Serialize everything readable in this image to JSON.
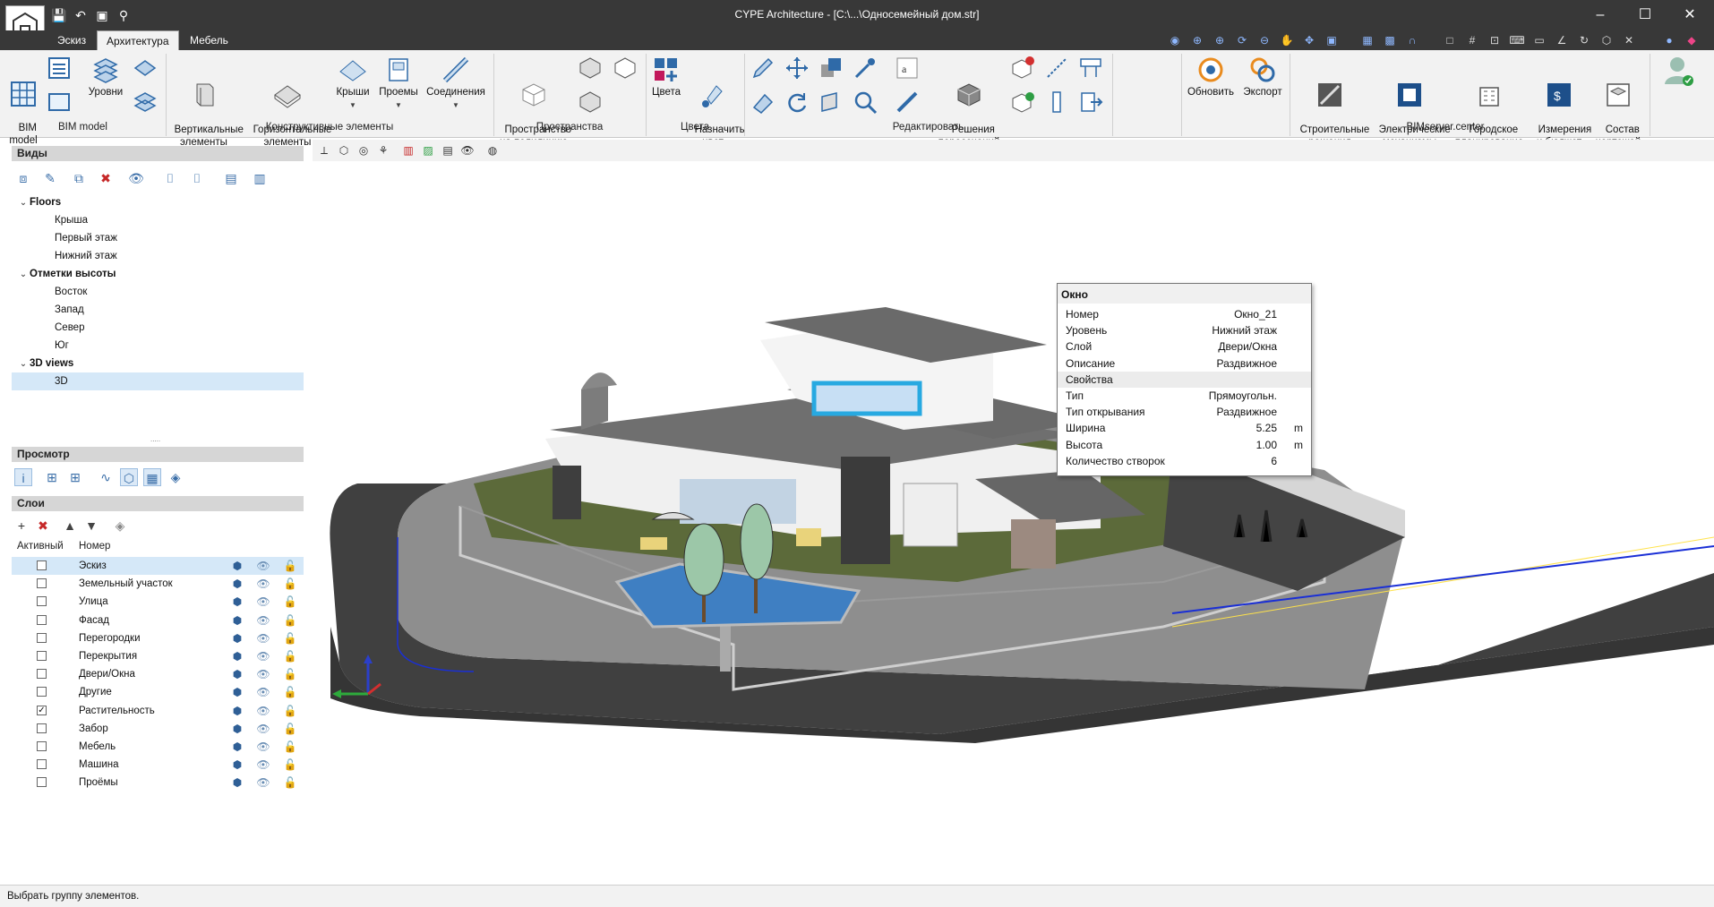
{
  "window": {
    "title": "CYPE Architecture - [C:\\...\\Односемейный дом.str]"
  },
  "tabs": [
    "Эскиз",
    "Архитектура",
    "Мебель"
  ],
  "ribbon": {
    "bim": {
      "model_label": "BIM\nmodel",
      "group": "BIM model"
    },
    "levels_label": "Уровни",
    "constructive": {
      "vertical": "Вертикальные\nэлементы",
      "horizontal": "Горизонтальные\nэлементы",
      "roofs": "Крыши",
      "openings": "Проемы",
      "joints": "Соединения",
      "group": "Конструктивные элементы"
    },
    "spaces": {
      "polyline": "Пространство\nна полилинию",
      "group": "Пространства"
    },
    "colors": {
      "colors": "Цвета",
      "assign": "Назначить\nцвет",
      "group": "Цвета"
    },
    "edit": {
      "intersections": "Решения\nпересечений",
      "group": "Редактировать"
    },
    "bimserver": {
      "update": "Обновить",
      "export": "Экспорт",
      "construction": "Строительные\nрешения",
      "electrical": "Электрические\nмеханизмы",
      "urban": "Городское\nпланирование",
      "measure": "Измерения\nи бюджет",
      "drawings": "Состав\nчертежей",
      "group": "BIMserver.center"
    }
  },
  "views": {
    "title": "Виды",
    "tree": [
      {
        "label": "Floors",
        "level": 0
      },
      {
        "label": "Крыша",
        "level": 1
      },
      {
        "label": "Первый этаж",
        "level": 1
      },
      {
        "label": "Нижний этаж",
        "level": 1
      },
      {
        "label": "Отметки высоты",
        "level": 0
      },
      {
        "label": "Восток",
        "level": 1
      },
      {
        "label": "Запад",
        "level": 1
      },
      {
        "label": "Север",
        "level": 1
      },
      {
        "label": "Юг",
        "level": 1
      },
      {
        "label": "3D views",
        "level": 0
      },
      {
        "label": "3D",
        "level": 1
      }
    ]
  },
  "preview": {
    "title": "Просмотр"
  },
  "layers": {
    "title": "Слои",
    "col_active": "Активный",
    "col_name": "Номер",
    "rows": [
      {
        "name": "Эскиз",
        "checked": false
      },
      {
        "name": "Земельный участок",
        "checked": false
      },
      {
        "name": "Улица",
        "checked": false
      },
      {
        "name": "Фасад",
        "checked": false
      },
      {
        "name": "Перегородки",
        "checked": false
      },
      {
        "name": "Перекрытия",
        "checked": false
      },
      {
        "name": "Двери/Окна",
        "checked": false
      },
      {
        "name": "Другие",
        "checked": false
      },
      {
        "name": "Растительность",
        "checked": true
      },
      {
        "name": "Забор",
        "checked": false
      },
      {
        "name": "Мебель",
        "checked": false
      },
      {
        "name": "Машина",
        "checked": false
      },
      {
        "name": "Проёмы",
        "checked": false
      }
    ]
  },
  "tooltip": {
    "title": "Окно",
    "rows": [
      {
        "k": "Номер",
        "v": "Окно_21",
        "u": ""
      },
      {
        "k": "Уровень",
        "v": "Нижний этаж",
        "u": ""
      },
      {
        "k": "Слой",
        "v": "Двери/Окна",
        "u": ""
      },
      {
        "k": "Описание",
        "v": "Раздвижное",
        "u": ""
      },
      {
        "k": "Свойства",
        "v": "",
        "u": "",
        "section": true
      },
      {
        "k": "Тип",
        "v": "Прямоугольн.",
        "u": ""
      },
      {
        "k": "Тип открывания",
        "v": "Раздвижное",
        "u": ""
      },
      {
        "k": "Ширина",
        "v": "5.25",
        "u": "m"
      },
      {
        "k": "Высота",
        "v": "1.00",
        "u": "m"
      },
      {
        "k": "Количество створок",
        "v": "6",
        "u": ""
      }
    ]
  },
  "status": "Выбрать группу элементов.",
  "colors": {
    "titlebar": "#383838",
    "ribbon": "#f2f2f2",
    "selection": "#d5e8f8",
    "highlight": "#27a9e1"
  }
}
